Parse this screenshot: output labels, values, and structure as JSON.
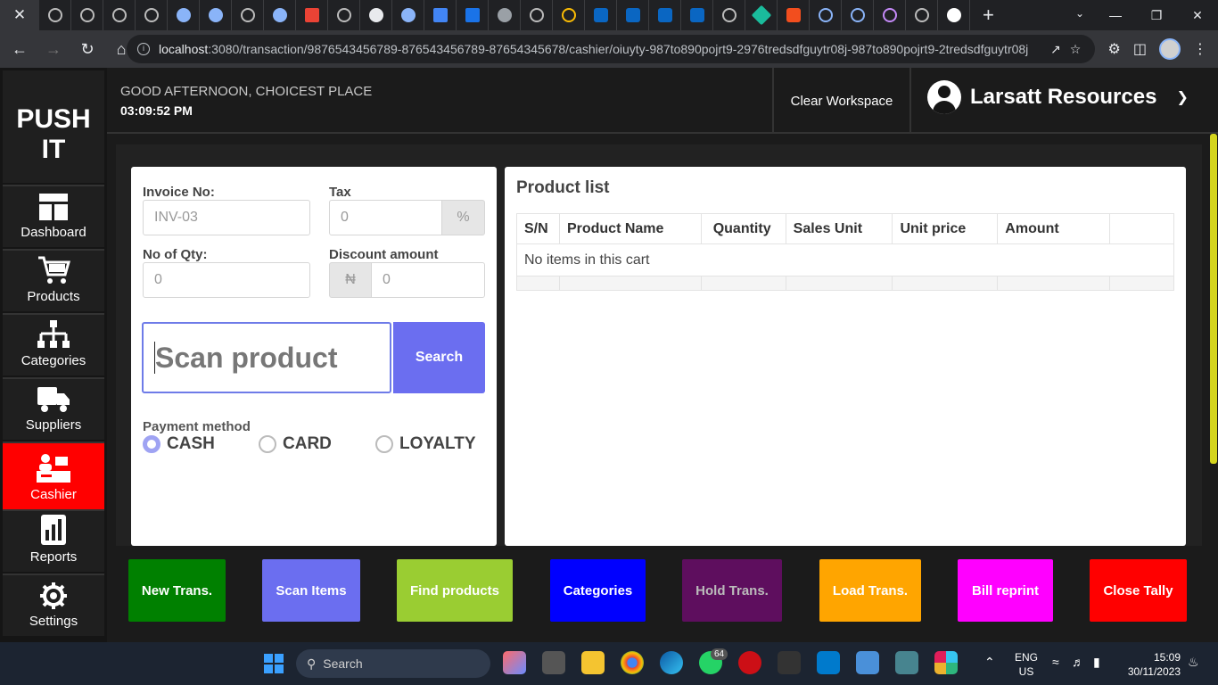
{
  "browser": {
    "active_tab_close": "✕",
    "url_host": "localhost",
    "url_path": ":3080/transaction/9876543456789-876543456789-87654345678/cashier/oiuyty-987to890pojrt9-2976tredsdfguytr08j-987to890pojrt9-2tredsdfguytr08j"
  },
  "app": {
    "logo": "PUSH IT",
    "greeting": "GOOD AFTERNOON, CHOICEST PLACE",
    "time": "03:09:52 PM",
    "clear_workspace": "Clear Workspace",
    "user_name": "Larsatt Resources"
  },
  "sidebar": {
    "items": [
      {
        "label": "Dashboard",
        "icon": "dashboard-icon"
      },
      {
        "label": "Products",
        "icon": "cart-icon"
      },
      {
        "label": "Categories",
        "icon": "hierarchy-icon"
      },
      {
        "label": "Suppliers",
        "icon": "truck-icon"
      },
      {
        "label": "Cashier",
        "icon": "cashier-icon"
      },
      {
        "label": "Reports",
        "icon": "report-icon"
      },
      {
        "label": "Settings",
        "icon": "gear-icon"
      }
    ],
    "active": "Cashier",
    "active_color": "#ff0000"
  },
  "form": {
    "invoice_label": "Invoice No:",
    "invoice_value": "INV-03",
    "tax_label": "Tax",
    "tax_placeholder": "0",
    "tax_suffix": "%",
    "qty_label": "No of Qty:",
    "qty_placeholder": "0",
    "discount_label": "Discount amount",
    "discount_prefix": "₦",
    "discount_placeholder": "0",
    "scan_placeholder": "Scan product",
    "search_button": "Search",
    "payment_label": "Payment method",
    "payment_options": [
      "CASH",
      "CARD",
      "LOYALTY"
    ],
    "payment_selected": "CASH"
  },
  "product_list": {
    "title": "Product list",
    "columns": [
      "S/N",
      "Product Name",
      "Quantity",
      "Sales Unit",
      "Unit price",
      "Amount",
      ""
    ],
    "empty_text": "No items in this cart"
  },
  "actions": [
    {
      "label": "New Trans.",
      "color": "#008000"
    },
    {
      "label": "Scan Items",
      "color": "#6b6ef0"
    },
    {
      "label": "Find products",
      "color": "#9acd32"
    },
    {
      "label": "Categories",
      "color": "#0000ff"
    },
    {
      "label": "Hold Trans.",
      "color": "#5e0e5e"
    },
    {
      "label": "Load Trans.",
      "color": "#ffa500"
    },
    {
      "label": "Bill reprint",
      "color": "#ff00ff"
    },
    {
      "label": "Close Tally",
      "color": "#ff0000"
    }
  ],
  "taskbar": {
    "search": "Search",
    "whatsapp_badge": "64",
    "lang_1": "ENG",
    "lang_2": "US",
    "time": "15:09",
    "date": "30/11/2023"
  }
}
